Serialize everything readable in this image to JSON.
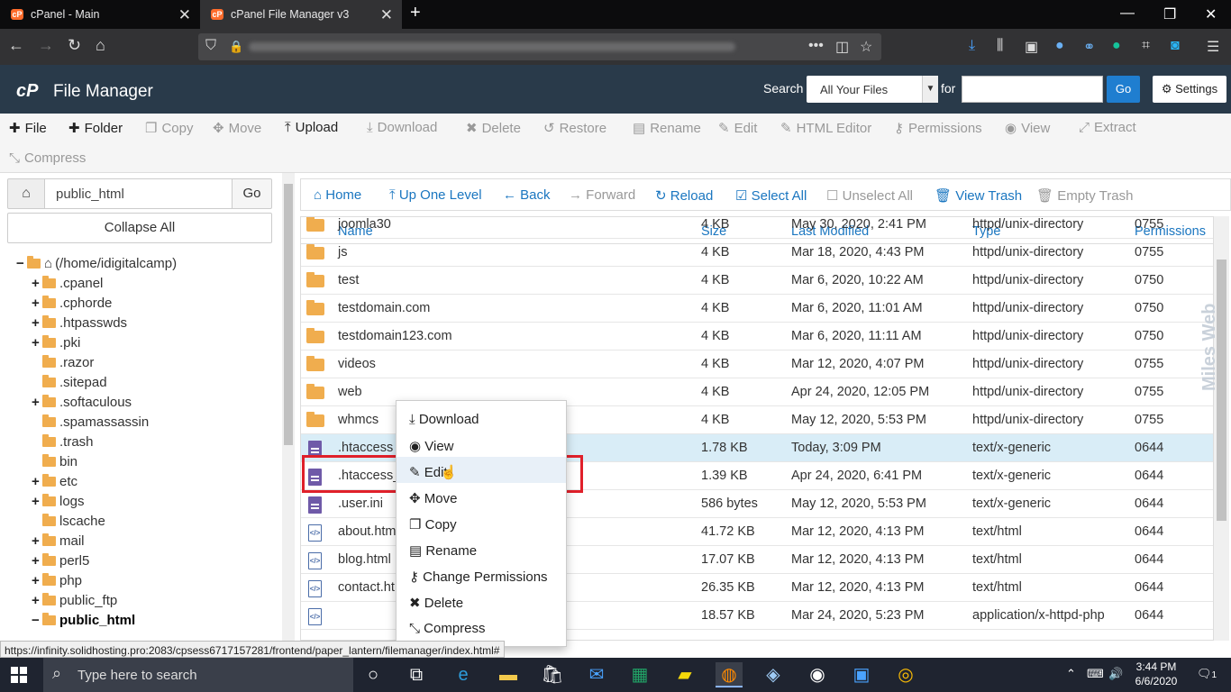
{
  "browser": {
    "tabs": [
      {
        "title": "cPanel - Main"
      },
      {
        "title": "cPanel File Manager v3"
      }
    ]
  },
  "header": {
    "logo": "cP",
    "title": "File Manager",
    "search_label": "Search",
    "search_scope": "All Your Files",
    "for_label": "for",
    "go_label": "Go",
    "settings_label": "Settings"
  },
  "toolbar": {
    "items": [
      {
        "label": "File",
        "icon": "plus-icon",
        "enabled": true
      },
      {
        "label": "Folder",
        "icon": "plus-icon",
        "enabled": true
      },
      {
        "label": "Copy",
        "icon": "copy-icon",
        "enabled": false
      },
      {
        "label": "Move",
        "icon": "move-icon",
        "enabled": false
      },
      {
        "label": "Upload",
        "icon": "upload-icon",
        "enabled": true
      },
      {
        "label": "Download",
        "icon": "download-icon",
        "enabled": false
      },
      {
        "label": "Delete",
        "icon": "delete-icon",
        "enabled": false
      },
      {
        "label": "Restore",
        "icon": "restore-icon",
        "enabled": false
      },
      {
        "label": "Rename",
        "icon": "rename-icon",
        "enabled": false
      },
      {
        "label": "Edit",
        "icon": "pencil-icon",
        "enabled": false
      },
      {
        "label": "HTML Editor",
        "icon": "html-editor-icon",
        "enabled": false
      },
      {
        "label": "Permissions",
        "icon": "key-icon",
        "enabled": false
      },
      {
        "label": "View",
        "icon": "eye-icon",
        "enabled": false
      },
      {
        "label": "Extract",
        "icon": "extract-icon",
        "enabled": false
      },
      {
        "label": "Compress",
        "icon": "compress-icon",
        "enabled": false
      }
    ]
  },
  "sidebar": {
    "path_value": "public_html",
    "go_label": "Go",
    "collapse_label": "Collapse All",
    "tree": [
      {
        "label": "(/home/idigitalcamp)",
        "toggle": "−",
        "home": true
      },
      {
        "label": ".cpanel",
        "toggle": "+"
      },
      {
        "label": ".cphorde",
        "toggle": "+"
      },
      {
        "label": ".htpasswds",
        "toggle": "+"
      },
      {
        "label": ".pki",
        "toggle": "+"
      },
      {
        "label": ".razor",
        "toggle": ""
      },
      {
        "label": ".sitepad",
        "toggle": ""
      },
      {
        "label": ".softaculous",
        "toggle": "+"
      },
      {
        "label": ".spamassassin",
        "toggle": ""
      },
      {
        "label": ".trash",
        "toggle": ""
      },
      {
        "label": "bin",
        "toggle": ""
      },
      {
        "label": "etc",
        "toggle": "+"
      },
      {
        "label": "logs",
        "toggle": "+"
      },
      {
        "label": "lscache",
        "toggle": ""
      },
      {
        "label": "mail",
        "toggle": "+"
      },
      {
        "label": "perl5",
        "toggle": "+"
      },
      {
        "label": "php",
        "toggle": "+"
      },
      {
        "label": "public_ftp",
        "toggle": "+"
      },
      {
        "label": "public_html",
        "toggle": "−",
        "bold": true
      }
    ]
  },
  "nav": {
    "items": [
      {
        "label": "Home",
        "icon": "home-icon",
        "enabled": true
      },
      {
        "label": "Up One Level",
        "icon": "up-arrow-icon",
        "enabled": true
      },
      {
        "label": "Back",
        "icon": "back-arrow-icon",
        "enabled": true
      },
      {
        "label": "Forward",
        "icon": "forward-arrow-icon",
        "enabled": false
      },
      {
        "label": "Reload",
        "icon": "reload-icon",
        "enabled": true
      },
      {
        "label": "Select All",
        "icon": "checkbox-checked-icon",
        "enabled": true
      },
      {
        "label": "Unselect All",
        "icon": "checkbox-empty-icon",
        "enabled": false
      },
      {
        "label": "View Trash",
        "icon": "trash-icon",
        "enabled": true
      },
      {
        "label": "Empty Trash",
        "icon": "trash-icon",
        "enabled": false
      }
    ]
  },
  "table": {
    "headers": [
      "Name",
      "Size",
      "Last Modified",
      "Type",
      "Permissions"
    ],
    "rows": [
      {
        "name": "joomla30",
        "size": "4 KB",
        "modified": "May 30, 2020, 2:41 PM",
        "type": "httpd/unix-directory",
        "perms": "0755",
        "kind": "folder"
      },
      {
        "name": "js",
        "size": "4 KB",
        "modified": "Mar 18, 2020, 4:43 PM",
        "type": "httpd/unix-directory",
        "perms": "0755",
        "kind": "folder"
      },
      {
        "name": "test",
        "size": "4 KB",
        "modified": "Mar 6, 2020, 10:22 AM",
        "type": "httpd/unix-directory",
        "perms": "0750",
        "kind": "folder"
      },
      {
        "name": "testdomain.com",
        "size": "4 KB",
        "modified": "Mar 6, 2020, 11:01 AM",
        "type": "httpd/unix-directory",
        "perms": "0750",
        "kind": "folder"
      },
      {
        "name": "testdomain123.com",
        "size": "4 KB",
        "modified": "Mar 6, 2020, 11:11 AM",
        "type": "httpd/unix-directory",
        "perms": "0750",
        "kind": "folder"
      },
      {
        "name": "videos",
        "size": "4 KB",
        "modified": "Mar 12, 2020, 4:07 PM",
        "type": "httpd/unix-directory",
        "perms": "0755",
        "kind": "folder"
      },
      {
        "name": "web",
        "size": "4 KB",
        "modified": "Apr 24, 2020, 12:05 PM",
        "type": "httpd/unix-directory",
        "perms": "0755",
        "kind": "folder"
      },
      {
        "name": "whmcs",
        "size": "4 KB",
        "modified": "May 12, 2020, 5:53 PM",
        "type": "httpd/unix-directory",
        "perms": "0755",
        "kind": "folder"
      },
      {
        "name": ".htaccess",
        "size": "1.78 KB",
        "modified": "Today, 3:09 PM",
        "type": "text/x-generic",
        "perms": "0644",
        "kind": "doc",
        "selected": true
      },
      {
        "name": ".htaccess_",
        "size": "1.39 KB",
        "modified": "Apr 24, 2020, 6:41 PM",
        "type": "text/x-generic",
        "perms": "0644",
        "kind": "doc"
      },
      {
        "name": ".user.ini",
        "size": "586 bytes",
        "modified": "May 12, 2020, 5:53 PM",
        "type": "text/x-generic",
        "perms": "0644",
        "kind": "doc"
      },
      {
        "name": "about.htm",
        "size": "41.72 KB",
        "modified": "Mar 12, 2020, 4:13 PM",
        "type": "text/html",
        "perms": "0644",
        "kind": "html"
      },
      {
        "name": "blog.html",
        "size": "17.07 KB",
        "modified": "Mar 12, 2020, 4:13 PM",
        "type": "text/html",
        "perms": "0644",
        "kind": "html"
      },
      {
        "name": "contact.htı",
        "size": "26.35 KB",
        "modified": "Mar 12, 2020, 4:13 PM",
        "type": "text/html",
        "perms": "0644",
        "kind": "html"
      },
      {
        "name": "",
        "size": "18.57 KB",
        "modified": "Mar 24, 2020, 5:23 PM",
        "type": "application/x-httpd-php",
        "perms": "0644",
        "kind": "php"
      }
    ]
  },
  "context_menu": {
    "items": [
      {
        "label": "Download",
        "icon": "download-icon"
      },
      {
        "label": "View",
        "icon": "eye-icon"
      },
      {
        "label": "Edit",
        "icon": "pencil-icon",
        "highlighted": true
      },
      {
        "label": "Move",
        "icon": "move-icon"
      },
      {
        "label": "Copy",
        "icon": "copy-icon"
      },
      {
        "label": "Rename",
        "icon": "rename-icon"
      },
      {
        "label": "Change Permissions",
        "icon": "key-icon"
      },
      {
        "label": "Delete",
        "icon": "delete-icon"
      },
      {
        "label": "Compress",
        "icon": "compress-icon"
      }
    ]
  },
  "watermark": "Miles Web",
  "status_url": "https://infinity.solidhosting.pro:2083/cpsess6717157281/frontend/paper_lantern/filemanager/index.html#",
  "taskbar": {
    "search_placeholder": "Type here to search",
    "time": "3:44 PM",
    "date": "6/6/2020",
    "notifications": "1"
  },
  "colors": {
    "header_bg": "#293a4a",
    "accent": "#1a76c0",
    "selected_row": "#d9edf7",
    "highlight_box": "#e0202a"
  }
}
